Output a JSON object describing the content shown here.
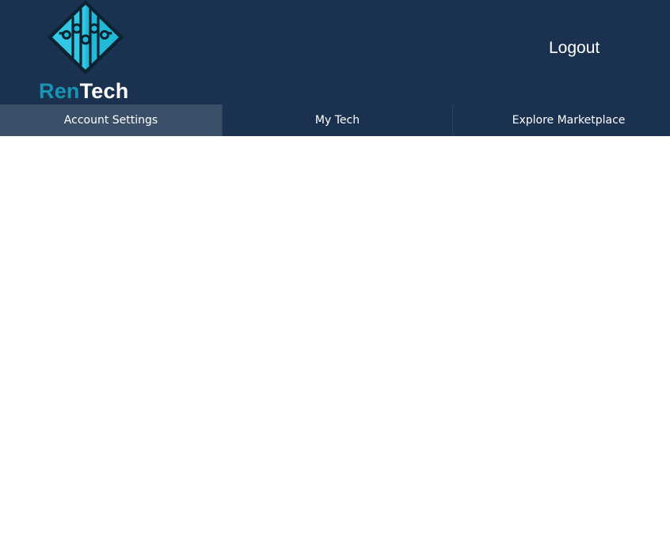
{
  "brand": {
    "name_part1": "Ren",
    "name_part2": "Tech",
    "logo_icon": "circuit-diamond-icon",
    "colors": {
      "header_bg": "#1a314f",
      "active_tab_bg": "#3b5068",
      "brand_accent": "#1795b3",
      "logo_cyan": "#26c6e8"
    }
  },
  "header": {
    "logout_label": "Logout"
  },
  "nav": {
    "tabs": [
      {
        "label": "Account Settings",
        "active": true
      },
      {
        "label": "My Tech",
        "active": false
      },
      {
        "label": "Explore Marketplace",
        "active": false
      }
    ]
  }
}
